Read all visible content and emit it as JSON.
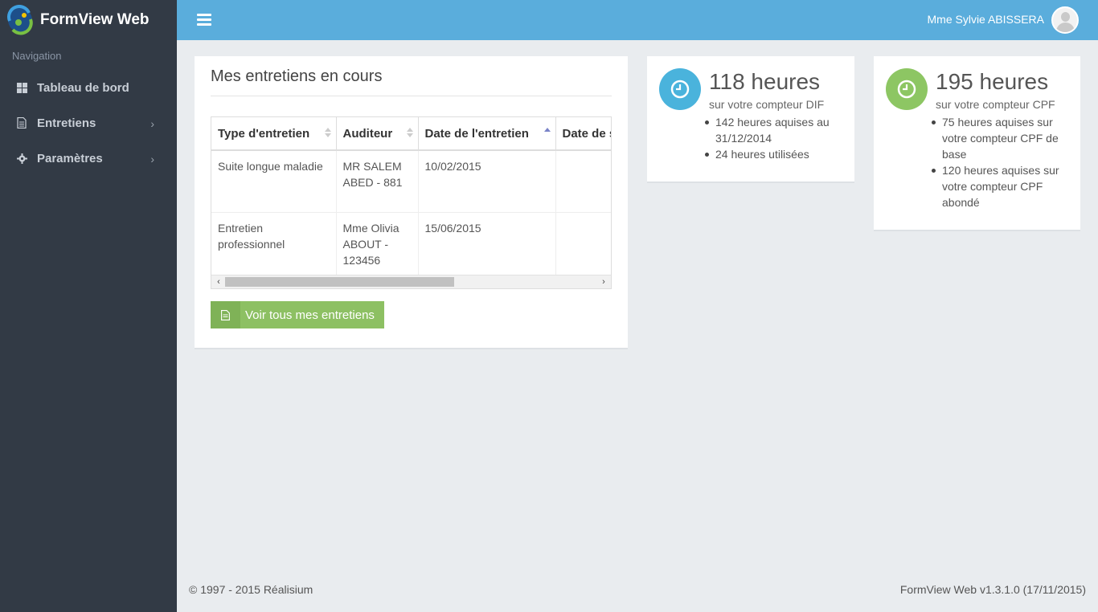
{
  "app": {
    "title": "FormView Web"
  },
  "sidebar": {
    "heading": "Navigation",
    "items": [
      {
        "label": "Tableau de bord",
        "icon": "dashboard-icon"
      },
      {
        "label": "Entretiens",
        "icon": "document-icon"
      },
      {
        "label": "Paramètres",
        "icon": "gear-icon"
      }
    ]
  },
  "header": {
    "user_name": "Mme Sylvie ABISSERA"
  },
  "main_panel": {
    "title": "Mes entretiens en cours",
    "columns": [
      "Type d'entretien",
      "Auditeur",
      "Date de l'entretien",
      "Date de s"
    ],
    "rows": [
      {
        "type": "Suite longue maladie",
        "auditeur": "MR SALEM ABED - 881",
        "date": "10/02/2015",
        "date2": ""
      },
      {
        "type": "Entretien professionnel",
        "auditeur": "Mme Olivia ABOUT - 123456",
        "date": "15/06/2015",
        "date2": ""
      }
    ],
    "button_label": "Voir tous mes entretiens"
  },
  "stats": [
    {
      "value": "118 heures",
      "subtitle": "sur votre compteur DIF",
      "color": "#4ab3dc",
      "items": [
        "142 heures aquises au 31/12/2014",
        "24 heures utilisées"
      ]
    },
    {
      "value": "195 heures",
      "subtitle": "sur votre compteur CPF",
      "color": "#8dc663",
      "items": [
        "75 heures aquises sur votre compteur CPF de base",
        "120 heures aquises sur votre compteur CPF abondé"
      ]
    }
  ],
  "footer": {
    "left": "© 1997 - 2015 Réalisium",
    "right": "FormView Web v1.3.1.0 (17/11/2015)"
  }
}
